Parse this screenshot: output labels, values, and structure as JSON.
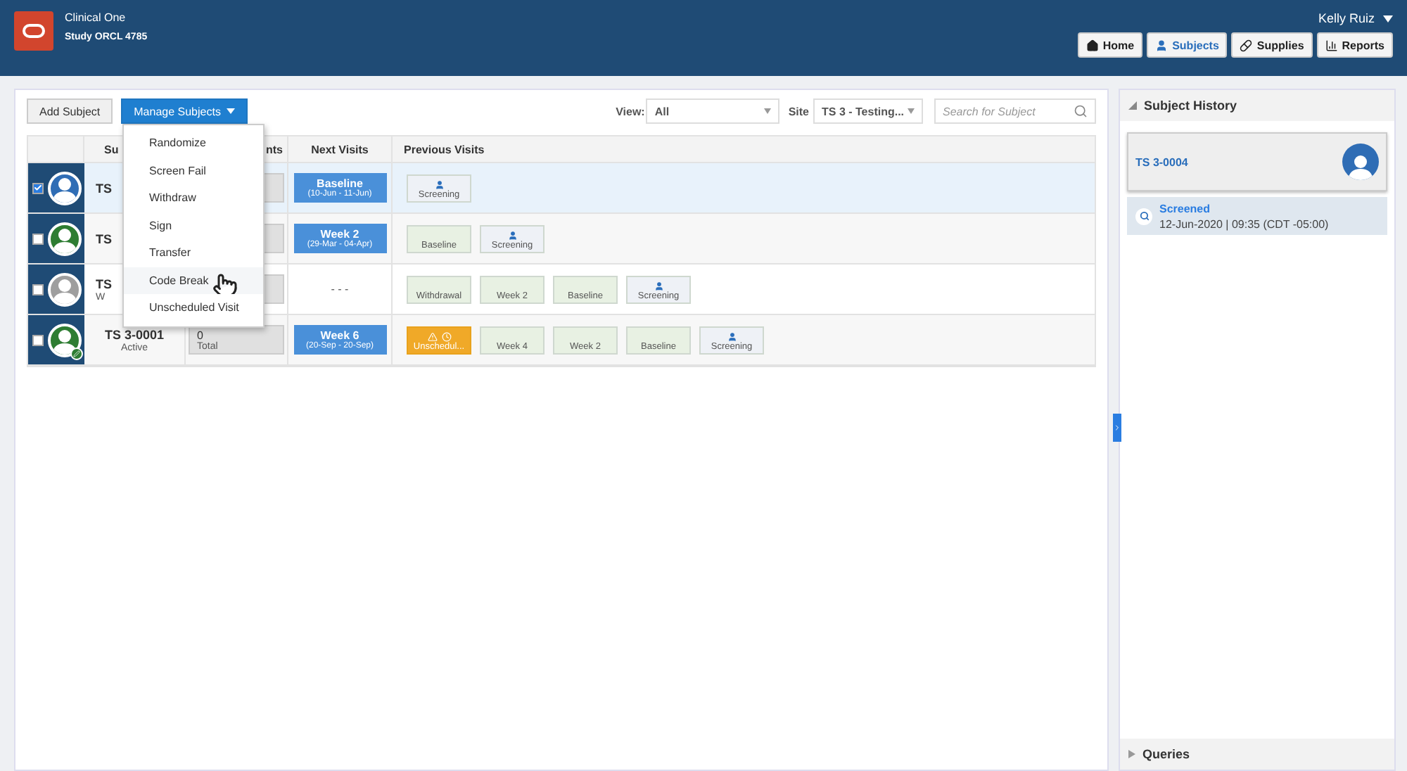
{
  "app": {
    "name": "Clinical One",
    "study": "Study ORCL 4785",
    "user": "Kelly Ruiz"
  },
  "nav": [
    {
      "label": "Home",
      "selected": false
    },
    {
      "label": "Subjects",
      "selected": true
    },
    {
      "label": "Supplies",
      "selected": false
    },
    {
      "label": "Reports",
      "selected": false
    }
  ],
  "toolbar": {
    "add": "Add Subject",
    "manage": "Manage Subjects",
    "view_label": "View:",
    "view_value": "All",
    "site_label": "Site",
    "site_value": "TS 3 - Testing...",
    "search_placeholder": "Search for Subject"
  },
  "menu": {
    "items": [
      {
        "label": "Randomize",
        "hovered": false
      },
      {
        "label": "Screen Fail",
        "hovered": false
      },
      {
        "label": "Withdraw",
        "hovered": false
      },
      {
        "label": "Sign",
        "hovered": false
      },
      {
        "label": "Transfer",
        "hovered": false
      },
      {
        "label": "Code Break",
        "hovered": true
      },
      {
        "label": "Unscheduled Visit",
        "hovered": false
      }
    ]
  },
  "table": {
    "columns": [
      "Su",
      "nts",
      "Next Visits",
      "Previous Visits"
    ],
    "rows": [
      {
        "selected": true,
        "color": "#2f6db5",
        "signed": false,
        "subject": "TS",
        "next": {
          "kind": "visit",
          "name": "Baseline",
          "dates": "(10-Jun - 11-Jun)"
        },
        "previous": [
          {
            "kind": "screening",
            "label": "Screening"
          }
        ]
      },
      {
        "selected": false,
        "color": "#2e7d32",
        "signed": false,
        "subject": "TS",
        "next": {
          "kind": "visit",
          "name": "Week 2",
          "dates": "(29-Mar - 04-Apr)"
        },
        "previous": [
          {
            "kind": "done",
            "label": "Baseline"
          },
          {
            "kind": "screening",
            "label": "Screening"
          }
        ]
      },
      {
        "selected": false,
        "color": "#9e9e9e",
        "signed": false,
        "subject": "TS",
        "status": "W",
        "next": {
          "kind": "none",
          "name": "- - -"
        },
        "previous": [
          {
            "kind": "done",
            "label": "Withdrawal"
          },
          {
            "kind": "done",
            "label": "Week 2"
          },
          {
            "kind": "done",
            "label": "Baseline"
          },
          {
            "kind": "screening",
            "label": "Screening"
          }
        ]
      },
      {
        "selected": false,
        "color": "#2e7d32",
        "signed": true,
        "subject": "TS 3-0001",
        "status": "Active",
        "events": {
          "count": "0",
          "label": "Total"
        },
        "next": {
          "kind": "visit",
          "name": "Week 6",
          "dates": "(20-Sep - 20-Sep)"
        },
        "previous": [
          {
            "kind": "unscheduled",
            "label": "Unschedul..."
          },
          {
            "kind": "done",
            "label": "Week 4"
          },
          {
            "kind": "done",
            "label": "Week 2"
          },
          {
            "kind": "done",
            "label": "Baseline"
          },
          {
            "kind": "screening",
            "label": "Screening"
          }
        ]
      }
    ]
  },
  "history": {
    "title": "Subject History",
    "subject": "TS 3-0004",
    "event": {
      "title": "Screened",
      "time": "12-Jun-2020 | 09:35 (CDT -05:00)"
    },
    "queries": "Queries",
    "expanded": true
  }
}
